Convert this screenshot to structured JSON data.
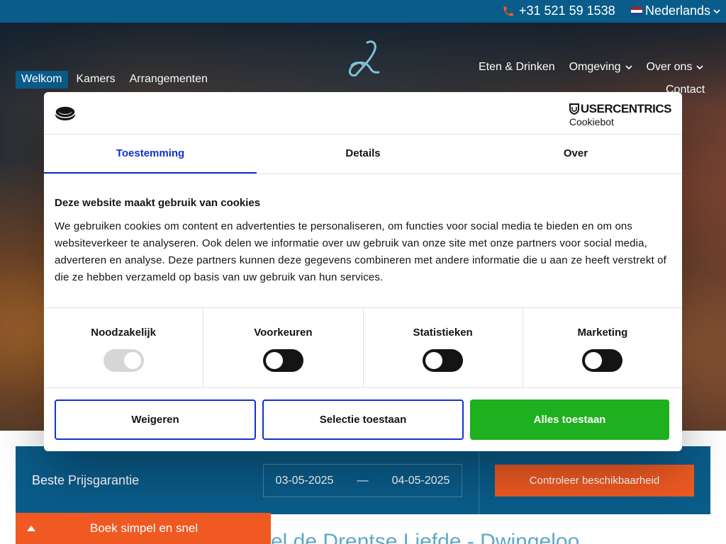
{
  "topbar": {
    "phone": "+31 521 59 1538",
    "language": "Nederlands",
    "colors": {
      "background": "#0a5c8a",
      "phone_icon": "#f05a22"
    }
  },
  "nav": {
    "left": [
      {
        "label": "Welkom",
        "active": true
      },
      {
        "label": "Kamers",
        "active": false
      },
      {
        "label": "Arrangementen",
        "active": false
      }
    ],
    "right": [
      {
        "label": "Eten & Drinken",
        "dropdown": false
      },
      {
        "label": "Omgeving",
        "dropdown": true
      },
      {
        "label": "Over ons",
        "dropdown": true
      }
    ],
    "contact": "Contact",
    "logo_icon": "script-l-logo"
  },
  "cookie_dialog": {
    "brand": "USERCENTRICS",
    "brand_sub": "Cookiebot",
    "tabs": [
      {
        "label": "Toestemming",
        "active": true
      },
      {
        "label": "Details",
        "active": false
      },
      {
        "label": "Over",
        "active": false
      }
    ],
    "heading": "Deze website maakt gebruik van cookies",
    "text": "We gebruiken cookies om content en advertenties te personaliseren, om functies voor social media te bieden en om ons websiteverkeer te analyseren. Ook delen we informatie over uw gebruik van onze site met onze partners voor social media, adverteren en analyse. Deze partners kunnen deze gegevens combineren met andere informatie die u aan ze heeft verstrekt of die ze hebben verzameld op basis van uw gebruik van hun services.",
    "categories": [
      {
        "label": "Noodzakelijk",
        "enabled": true,
        "disabled": true
      },
      {
        "label": "Voorkeuren",
        "enabled": false,
        "disabled": false
      },
      {
        "label": "Statistieken",
        "enabled": false,
        "disabled": false
      },
      {
        "label": "Marketing",
        "enabled": false,
        "disabled": false
      }
    ],
    "buttons": {
      "deny": "Weigeren",
      "allow_selection": "Selectie toestaan",
      "allow_all": "Alles toestaan"
    },
    "colors": {
      "accent": "#1032cf",
      "allow_all": "#1eb01e"
    }
  },
  "booking": {
    "title": "Beste Prijsgarantie",
    "date_from": "03-05-2025",
    "date_separator": "—",
    "date_to": "04-05-2025",
    "check_button": "Controleer beschikbaarheid",
    "book_tab": "Boek simpel en snel",
    "colors": {
      "bar": "#0a5c8a",
      "cta": "#f05a22"
    }
  },
  "page_heading_peek": "el de Drentse Liefde - Dwingeloo"
}
